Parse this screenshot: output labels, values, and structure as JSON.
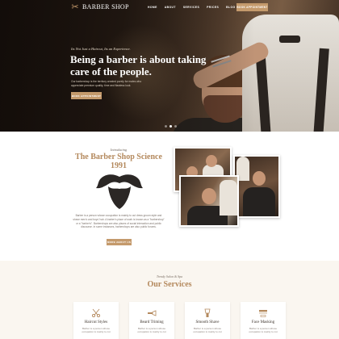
{
  "nav": {
    "logo_text": "BARBER SHOP",
    "logo_sub": "",
    "items": [
      "HOME",
      "ABOUT",
      "SERVICES",
      "PRICES",
      "BLOG",
      "CONTACT"
    ],
    "cta": "BOOK APPOINTMENT"
  },
  "hero": {
    "eyebrow": "Its Not Just a Haircut, Its an Experience.",
    "title": "Being a barber is about taking care of the people.",
    "text": "Our barbershop is the territory created purely for males who appreciate premium quality, time and flawless look.",
    "button": "BOOK APPOINTMENT",
    "slide_count": 3,
    "active_slide": 2
  },
  "intro": {
    "kicker": "Introducing",
    "title": "The Barber Shop Science 1991",
    "text": "Barber is a person whose occupation is mainly to cut dress groom style and shave men's and boys' hair. A barber's place of work is known as a \"barbershop\" or a \"barber's\". Barbershops are also places of social interaction and public discourse. In some instances, barbershops are also public forums.",
    "button": "MORE ABOUT US"
  },
  "services": {
    "kicker": "Trendy Salon & Spa",
    "title": "Our Services",
    "items": [
      {
        "title": "Haircut Styles",
        "text": "Barber is a person whose occupation is mainly to cut",
        "icon": "scissors-comb-icon"
      },
      {
        "title": "Beard Triming",
        "text": "Barber is a person whose occupation is mainly to cut",
        "icon": "razor-icon"
      },
      {
        "title": "Smooth Shave",
        "text": "Barber is a person whose occupation is mainly to cut",
        "icon": "shaving-brush-icon"
      },
      {
        "title": "Face Masking",
        "text": "Barber is a person whose occupation is mainly to cut",
        "icon": "comb-brush-icon"
      }
    ]
  },
  "colors": {
    "accent": "#c49a6c",
    "heading_gold": "#b4895d",
    "dark": "#1c1410"
  }
}
